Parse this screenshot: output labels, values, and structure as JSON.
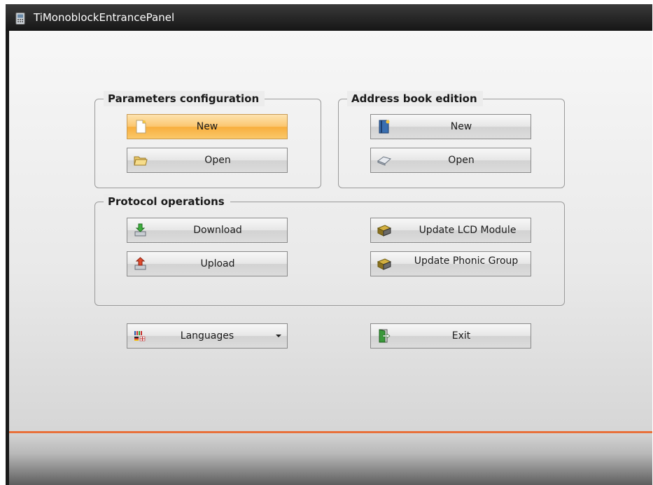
{
  "window": {
    "title": "TiMonoblockEntrancePanel"
  },
  "groups": {
    "parameters": {
      "title": "Parameters configuration",
      "new_label": "New",
      "open_label": "Open"
    },
    "address_book": {
      "title": "Address book edition",
      "new_label": "New",
      "open_label": "Open"
    },
    "protocol": {
      "title": "Protocol operations",
      "download_label": "Download",
      "upload_label": "Upload",
      "update_lcd_label": "Update LCD Module",
      "update_phonic_label": "Update Phonic Group"
    }
  },
  "bottom": {
    "languages_label": "Languages",
    "exit_label": "Exit"
  },
  "colors": {
    "accent_orange": "#e8703a",
    "active_button": "#f8ae3d",
    "titlebar": "#1f1f1f"
  }
}
